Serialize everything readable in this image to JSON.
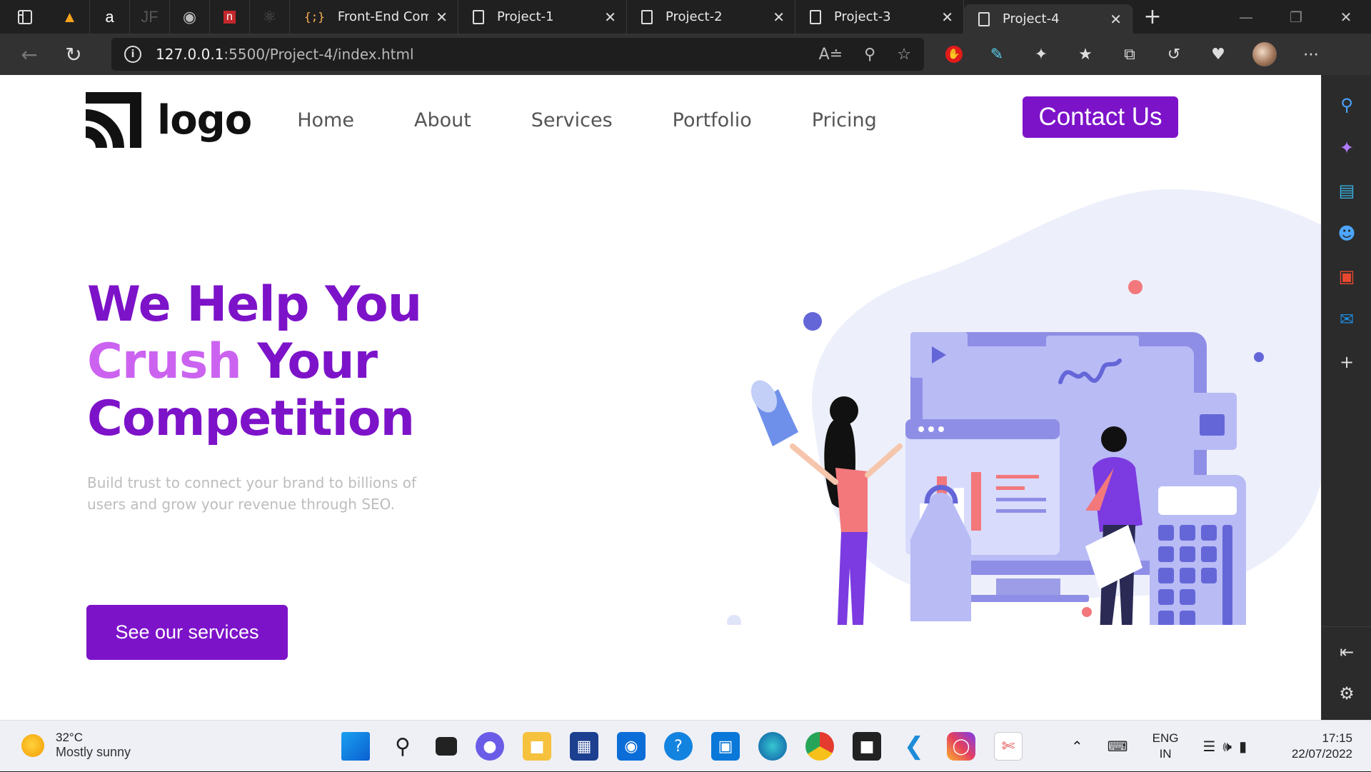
{
  "browser": {
    "tabs": [
      {
        "title": "Front-End Comm",
        "icon": "braces-icon",
        "active": false
      },
      {
        "title": "Project-1",
        "icon": "document-icon",
        "active": false
      },
      {
        "title": "Project-2",
        "icon": "document-icon",
        "active": false
      },
      {
        "title": "Project-3",
        "icon": "document-icon",
        "active": false
      },
      {
        "title": "Project-4",
        "icon": "document-icon",
        "active": true
      }
    ],
    "address": {
      "host": "127.0.0.1",
      "path": ":5500/Project-4/index.html"
    }
  },
  "site": {
    "logo_text": "logo",
    "nav": [
      "Home",
      "About",
      "Services",
      "Portfolio",
      "Pricing"
    ],
    "contact_label": "Contact Us",
    "hero": {
      "line1": "We Help You",
      "line2_accent": "Crush",
      "line2_rest": "Your",
      "line3": "Competition",
      "description": "Build trust to connect your brand to billions of users and grow your revenue through SEO.",
      "cta_label": "See our services"
    },
    "colors": {
      "primary": "#7d13c9",
      "accent": "#cb63f0"
    }
  },
  "taskbar": {
    "weather": {
      "temp": "32°C",
      "condition": "Mostly sunny"
    },
    "lang": {
      "line1": "ENG",
      "line2": "IN"
    },
    "clock": {
      "time": "17:15",
      "date": "22/07/2022"
    }
  }
}
